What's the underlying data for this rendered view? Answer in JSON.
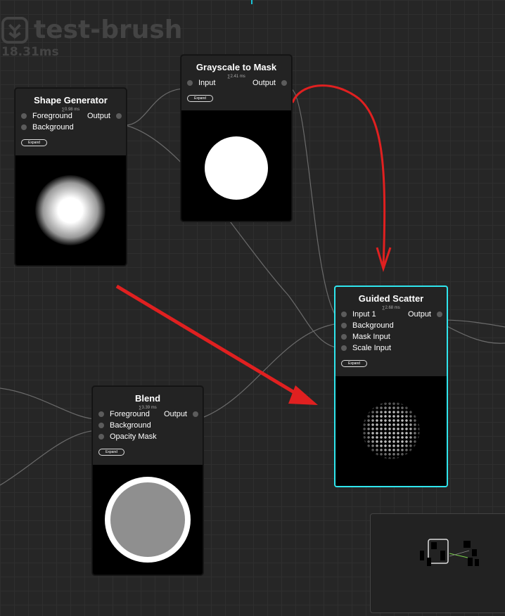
{
  "graph": {
    "title": "test-brush",
    "timing": "18.31ms"
  },
  "nodes": {
    "shape_generator": {
      "title": "Shape Generator",
      "time": "∑0.98 ms",
      "inputs": [
        "Foreground",
        "Background"
      ],
      "output": "Output",
      "expand": "Expand"
    },
    "grayscale_to_mask": {
      "title": "Grayscale to Mask",
      "time": "∑2.41 ms",
      "inputs": [
        "Input"
      ],
      "output": "Output",
      "expand": "Expand"
    },
    "guided_scatter": {
      "title": "Guided Scatter",
      "time": "∑2.68 ms",
      "inputs": [
        "Input 1",
        "Background",
        "Mask Input",
        "Scale Input"
      ],
      "output": "Output",
      "expand": "Expand"
    },
    "blend": {
      "title": "Blend",
      "time": "∑3.39 ms",
      "inputs": [
        "Foreground",
        "Background",
        "Opacity Mask"
      ],
      "output": "Output",
      "expand": "Expand"
    }
  },
  "colors": {
    "selected_border": "#2fe6ee",
    "annotation": "#e02020",
    "wire": "#6a6a6a"
  },
  "icons": {
    "logo": "brush-logo-icon"
  }
}
